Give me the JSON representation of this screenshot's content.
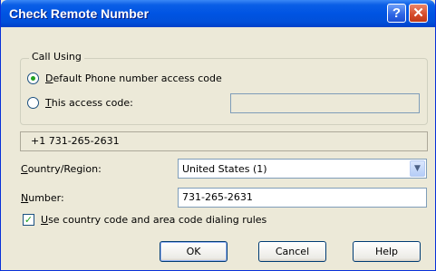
{
  "window": {
    "title": "Check Remote Number"
  },
  "titlebar": {
    "help_glyph": "?",
    "close_glyph": "✕"
  },
  "call_using": {
    "legend": "Call Using",
    "default_option": {
      "accel": "D",
      "rest": "efault Phone number access code",
      "selected": true
    },
    "this_code_option": {
      "accel": "T",
      "rest": "his access code:",
      "selected": false,
      "value": ""
    }
  },
  "resolved_number": "+1 731-265-2631",
  "country_region": {
    "label_accel": "C",
    "label_rest": "ountry/Region:",
    "selected": "United States (1)",
    "arrow_glyph": "▼"
  },
  "number": {
    "label_accel": "N",
    "label_rest": "umber:",
    "value": "731-265-2631"
  },
  "dialing_rules": {
    "accel": "U",
    "rest": "se country code and area code dialing rules",
    "checked": true,
    "check_glyph": "✓"
  },
  "buttons": {
    "ok": "OK",
    "cancel": "Cancel",
    "help": "Help"
  },
  "colors": {
    "titlebar": "#0054e3",
    "face": "#ece9d8",
    "radio_dot": "#21a121"
  }
}
